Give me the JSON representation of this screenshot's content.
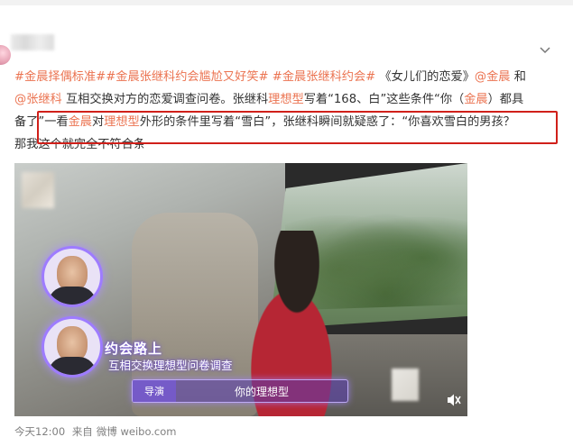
{
  "post": {
    "line1": {
      "tag1": "#金晨择偶标准#",
      "tag2": "#金晨张继科约会尴尬又好笑#",
      "tag3": "#金晨张继科约会#",
      "title_text": "《女儿们的恋爱》",
      "mention1": "@金晨",
      "and": "和"
    },
    "line2": {
      "mention2": "@张继科",
      "text_a": "互相交换对方的恋爱调查问卷。张继科",
      "kw_ideal": "理想型",
      "text_b": "写着“168、白”这些条件“你（",
      "kw_jinchen": "金晨",
      "text_c": "）都具"
    },
    "line3": {
      "text_a": "备了”",
      "text_b": "一看",
      "kw_jinchen": "金晨",
      "text_c": "对",
      "kw_ideal": "理想型",
      "text_d": "外形的条件里写着“雪白”，张继科瞬间就疑惑了：“你喜欢雪白的男孩？",
      "text_e": ""
    },
    "line4": {
      "text": "那我这个就完全不符合条"
    }
  },
  "video": {
    "date_label": "约会路上",
    "date_sub": "互相交换理想型问卷调查",
    "dialog_speaker": "导演",
    "dialog_text": "你的理想型"
  },
  "meta": {
    "time": "今天12:00",
    "from_label": "来自",
    "source": "微博 weibo.com"
  },
  "icons": {
    "chevron": "chevron-down-icon",
    "mute": "volume-mute-icon"
  },
  "colors": {
    "link_orange": "#eb7350",
    "highlight_red": "#d0201a",
    "video_accent": "#9e7cff"
  }
}
